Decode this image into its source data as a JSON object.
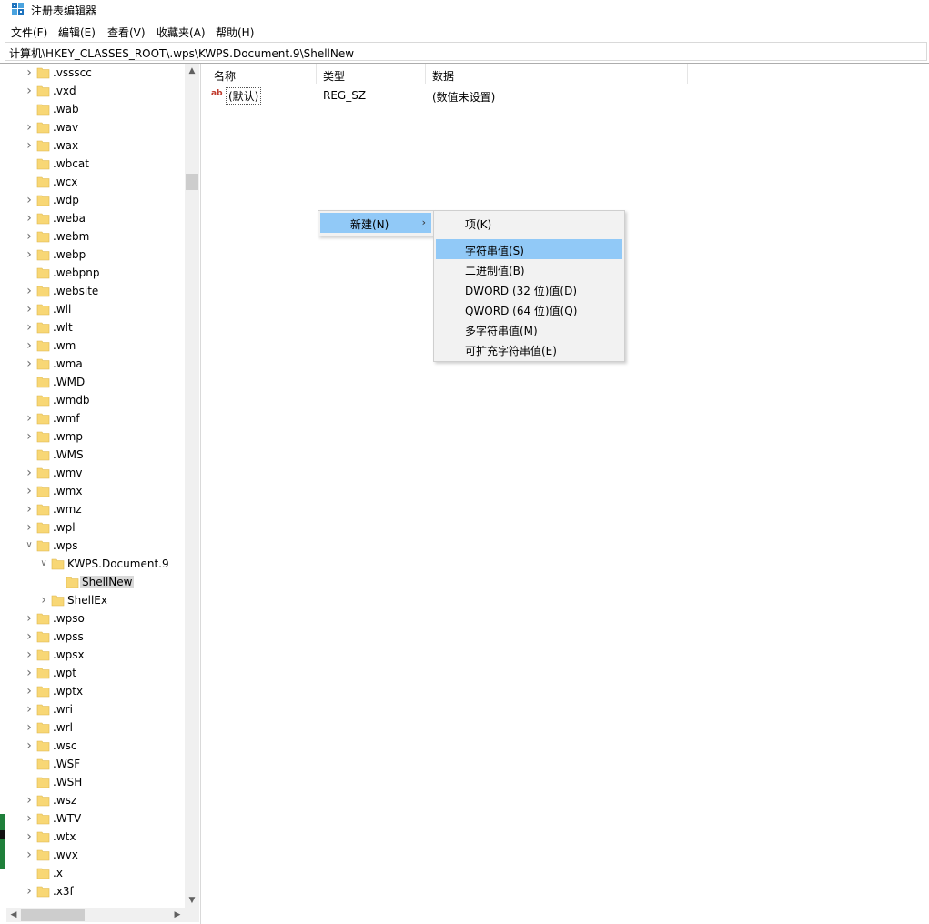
{
  "window": {
    "title": "注册表编辑器"
  },
  "menu": [
    "文件(F)",
    "编辑(E)",
    "查看(V)",
    "收藏夹(A)",
    "帮助(H)"
  ],
  "address": "计算机\\HKEY_CLASSES_ROOT\\.wps\\KWPS.Document.9\\ShellNew",
  "tree": [
    {
      "label": ".vssscc",
      "depth": 0,
      "expander": "collapsed"
    },
    {
      "label": ".vxd",
      "depth": 0,
      "expander": "collapsed"
    },
    {
      "label": ".wab",
      "depth": 0,
      "expander": "none"
    },
    {
      "label": ".wav",
      "depth": 0,
      "expander": "collapsed"
    },
    {
      "label": ".wax",
      "depth": 0,
      "expander": "collapsed"
    },
    {
      "label": ".wbcat",
      "depth": 0,
      "expander": "none"
    },
    {
      "label": ".wcx",
      "depth": 0,
      "expander": "none"
    },
    {
      "label": ".wdp",
      "depth": 0,
      "expander": "collapsed"
    },
    {
      "label": ".weba",
      "depth": 0,
      "expander": "collapsed"
    },
    {
      "label": ".webm",
      "depth": 0,
      "expander": "collapsed"
    },
    {
      "label": ".webp",
      "depth": 0,
      "expander": "collapsed"
    },
    {
      "label": ".webpnp",
      "depth": 0,
      "expander": "none"
    },
    {
      "label": ".website",
      "depth": 0,
      "expander": "collapsed"
    },
    {
      "label": ".wll",
      "depth": 0,
      "expander": "collapsed"
    },
    {
      "label": ".wlt",
      "depth": 0,
      "expander": "collapsed"
    },
    {
      "label": ".wm",
      "depth": 0,
      "expander": "collapsed"
    },
    {
      "label": ".wma",
      "depth": 0,
      "expander": "collapsed"
    },
    {
      "label": ".WMD",
      "depth": 0,
      "expander": "none"
    },
    {
      "label": ".wmdb",
      "depth": 0,
      "expander": "none"
    },
    {
      "label": ".wmf",
      "depth": 0,
      "expander": "collapsed"
    },
    {
      "label": ".wmp",
      "depth": 0,
      "expander": "collapsed"
    },
    {
      "label": ".WMS",
      "depth": 0,
      "expander": "none"
    },
    {
      "label": ".wmv",
      "depth": 0,
      "expander": "collapsed"
    },
    {
      "label": ".wmx",
      "depth": 0,
      "expander": "collapsed"
    },
    {
      "label": ".wmz",
      "depth": 0,
      "expander": "collapsed"
    },
    {
      "label": ".wpl",
      "depth": 0,
      "expander": "collapsed"
    },
    {
      "label": ".wps",
      "depth": 0,
      "expander": "expanded"
    },
    {
      "label": "KWPS.Document.9",
      "depth": 1,
      "expander": "expanded"
    },
    {
      "label": "ShellNew",
      "depth": 2,
      "expander": "none",
      "selected": true
    },
    {
      "label": "ShellEx",
      "depth": 1,
      "expander": "collapsed"
    },
    {
      "label": ".wpso",
      "depth": 0,
      "expander": "collapsed"
    },
    {
      "label": ".wpss",
      "depth": 0,
      "expander": "collapsed"
    },
    {
      "label": ".wpsx",
      "depth": 0,
      "expander": "collapsed"
    },
    {
      "label": ".wpt",
      "depth": 0,
      "expander": "collapsed"
    },
    {
      "label": ".wptx",
      "depth": 0,
      "expander": "collapsed"
    },
    {
      "label": ".wri",
      "depth": 0,
      "expander": "collapsed"
    },
    {
      "label": ".wrl",
      "depth": 0,
      "expander": "collapsed"
    },
    {
      "label": ".wsc",
      "depth": 0,
      "expander": "collapsed"
    },
    {
      "label": ".WSF",
      "depth": 0,
      "expander": "none"
    },
    {
      "label": ".WSH",
      "depth": 0,
      "expander": "none"
    },
    {
      "label": ".wsz",
      "depth": 0,
      "expander": "collapsed"
    },
    {
      "label": ".WTV",
      "depth": 0,
      "expander": "collapsed"
    },
    {
      "label": ".wtx",
      "depth": 0,
      "expander": "collapsed"
    },
    {
      "label": ".wvx",
      "depth": 0,
      "expander": "collapsed"
    },
    {
      "label": ".x",
      "depth": 0,
      "expander": "none"
    },
    {
      "label": ".x3f",
      "depth": 0,
      "expander": "collapsed"
    }
  ],
  "list": {
    "headers": {
      "name": "名称",
      "type": "类型",
      "data": "数据"
    },
    "rows": [
      {
        "icon": "string-value-icon",
        "icon_text": "ab",
        "name": "(默认)",
        "type": "REG_SZ",
        "data": "(数值未设置)"
      }
    ]
  },
  "context_menu": {
    "new_label": "新建(N)",
    "submenu": [
      {
        "label": "项(K)"
      },
      {
        "label": "字符串值(S)",
        "highlighted": true
      },
      {
        "label": "二进制值(B)"
      },
      {
        "label": "DWORD (32 位)值(D)"
      },
      {
        "label": "QWORD (64 位)值(Q)"
      },
      {
        "label": "多字符串值(M)"
      },
      {
        "label": "可扩充字符串值(E)"
      }
    ]
  },
  "colors": {
    "highlight": "#91c9f7",
    "folder": "#f8d775",
    "selected_bg": "#d9d9d9"
  }
}
